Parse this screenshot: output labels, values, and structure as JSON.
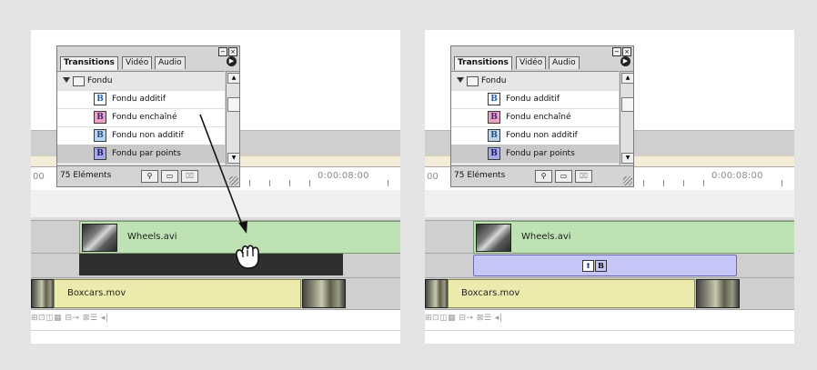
{
  "palette": {
    "tabs": [
      "Transitions",
      "Vidéo",
      "Audio"
    ],
    "menu_icon": "palette-menu-arrow",
    "minimize_icon": "minimize-icon",
    "close_icon": "close-icon",
    "folder": {
      "label": "Fondu",
      "expanded": true
    },
    "items": [
      {
        "label": "Fondu additif",
        "icon_color": "#ffffff"
      },
      {
        "label": "Fondu enchaîné",
        "icon_color": "#f0a0c0"
      },
      {
        "label": "Fondu non additif",
        "icon_color": "#b6d6f4"
      },
      {
        "label": "Fondu par points",
        "icon_color": "#a8a8ec",
        "selected": true
      }
    ],
    "item_icon_glyph": "B",
    "count_label": "75 Eléments",
    "status_buttons": [
      "binoculars-icon",
      "new-folder-icon",
      "trash-icon"
    ]
  },
  "timeline": {
    "ruler_left_label": "00",
    "ruler_time": "0:00:08:00",
    "clip_top": {
      "name": "Wheels.avi",
      "color": "#bfe2b4"
    },
    "clip_bottom": {
      "name": "Boxcars.mov",
      "color": "#ecebad"
    },
    "transition_placeholder_color": "#2f2f2f",
    "transition_placed_color": "#c6c6f8",
    "transition_icons": [
      "direction-arrow-icon",
      "fondu-par-points-icon"
    ],
    "bottom_controls_text": "⊞⊡◫▦ ⊟→ ⊠☰ ◂|"
  },
  "left_panel": {
    "state": "dragging",
    "cursor": "grab-hand-icon"
  },
  "right_panel": {
    "state": "transition-applied"
  }
}
